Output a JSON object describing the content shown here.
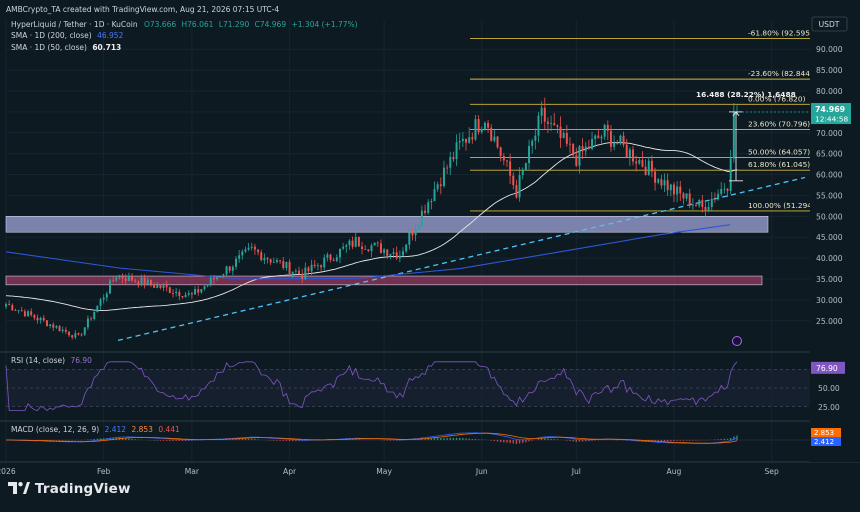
{
  "header": {
    "created_by": "AMBCrypto_TA created with TradingView.com, Aug 21, 2026 07:15 UTC-4"
  },
  "symbol": {
    "name": "HyperLiquid / Tether · 1D · KuCoin",
    "open": "O73.666",
    "high": "H76.061",
    "low": "L71.290",
    "close": "C74.969",
    "change": "+1.304 (+1.77%)"
  },
  "indicators": {
    "sma200": {
      "label": "SMA · 1D (200, close)",
      "value": "46.952",
      "color": "#2f56d6"
    },
    "sma50": {
      "label": "SMA · 1D (50, close)",
      "value": "60.713",
      "color": "#e8e8e8"
    },
    "rsi": {
      "label": "RSI (14, close)",
      "value": "76.90",
      "color": "#7e57c2",
      "levels": [
        "75.00",
        "50.00",
        "25.00"
      ]
    },
    "macd": {
      "label": "MACD (close, 12, 26, 9)",
      "macd": "2.412",
      "signal": "2.853",
      "hist": "0.441",
      "macd_color": "#2962ff",
      "signal_color": "#ff6d00",
      "zero_label": "0.00"
    }
  },
  "price_axis": {
    "currency": "USDT",
    "ticks": [
      "90.000",
      "85.000",
      "80.000",
      "75.000",
      "70.000",
      "65.000",
      "60.000",
      "55.000",
      "50.000",
      "45.000",
      "40.000",
      "35.000",
      "30.000",
      "25.000"
    ],
    "current_price": "74.969",
    "countdown": "12:44:58"
  },
  "time_axis": {
    "labels": [
      "2026",
      "Feb",
      "Mar",
      "Apr",
      "May",
      "Jun",
      "Jul",
      "Aug",
      "Sep"
    ]
  },
  "fibonacci": [
    {
      "label": "-61.80% (92.595)",
      "price": 92.595
    },
    {
      "label": "-23.60% (82.844)",
      "price": 82.844
    },
    {
      "label": "0.00% (76.820)",
      "price": 76.82
    },
    {
      "label": "23.60% (70.796)",
      "price": 70.796
    },
    {
      "label": "50.00% (64.057)",
      "price": 64.057
    },
    {
      "label": "61.80% (61.045)",
      "price": 61.045
    },
    {
      "label": "100.00% (51.294)",
      "price": 51.294
    }
  ],
  "measure": {
    "label": "16.488 (28.22%) 1,6488",
    "from": 58.5,
    "to": 75.0
  },
  "zones": [
    {
      "name": "resistance-zone-upper",
      "low": 46.2,
      "high": 50.0,
      "color": "#9aa0d2"
    },
    {
      "name": "resistance-zone-lower",
      "low": 33.6,
      "high": 35.7,
      "color": "#b0416b"
    }
  ],
  "brand": {
    "logo_text": "TradingView"
  },
  "colors": {
    "up": "#26a69a",
    "down": "#ef5350",
    "fib": "#d4b83a",
    "trendline": "#4fc3f7",
    "background": "#0e1a22"
  },
  "chart_data": {
    "type": "candlestick",
    "title": "HyperLiquid / Tether · 1D · KuCoin",
    "ylim": [
      18,
      97
    ],
    "y_unit": "USDT",
    "x_range": [
      "2026-01-01",
      "2026-09-10"
    ],
    "key_prices": [
      {
        "date": "2026-01-01",
        "close": 29
      },
      {
        "date": "2026-01-24",
        "close": 21
      },
      {
        "date": "2026-02-05",
        "close": 36
      },
      {
        "date": "2026-03-01",
        "close": 31
      },
      {
        "date": "2026-03-20",
        "close": 42
      },
      {
        "date": "2026-04-05",
        "close": 36
      },
      {
        "date": "2026-04-22",
        "close": 44
      },
      {
        "date": "2026-05-06",
        "close": 41
      },
      {
        "date": "2026-05-18",
        "close": 58
      },
      {
        "date": "2026-05-25",
        "close": 67
      },
      {
        "date": "2026-06-02",
        "close": 74
      },
      {
        "date": "2026-06-12",
        "close": 56
      },
      {
        "date": "2026-06-20",
        "close": 74
      },
      {
        "date": "2026-07-01",
        "close": 64
      },
      {
        "date": "2026-07-10",
        "close": 70
      },
      {
        "date": "2026-07-20",
        "close": 64
      },
      {
        "date": "2026-08-01",
        "close": 56
      },
      {
        "date": "2026-08-10",
        "close": 52
      },
      {
        "date": "2026-08-18",
        "close": 58
      },
      {
        "date": "2026-08-20",
        "close": 73.7
      },
      {
        "date": "2026-08-21",
        "close": 74.969
      }
    ]
  }
}
